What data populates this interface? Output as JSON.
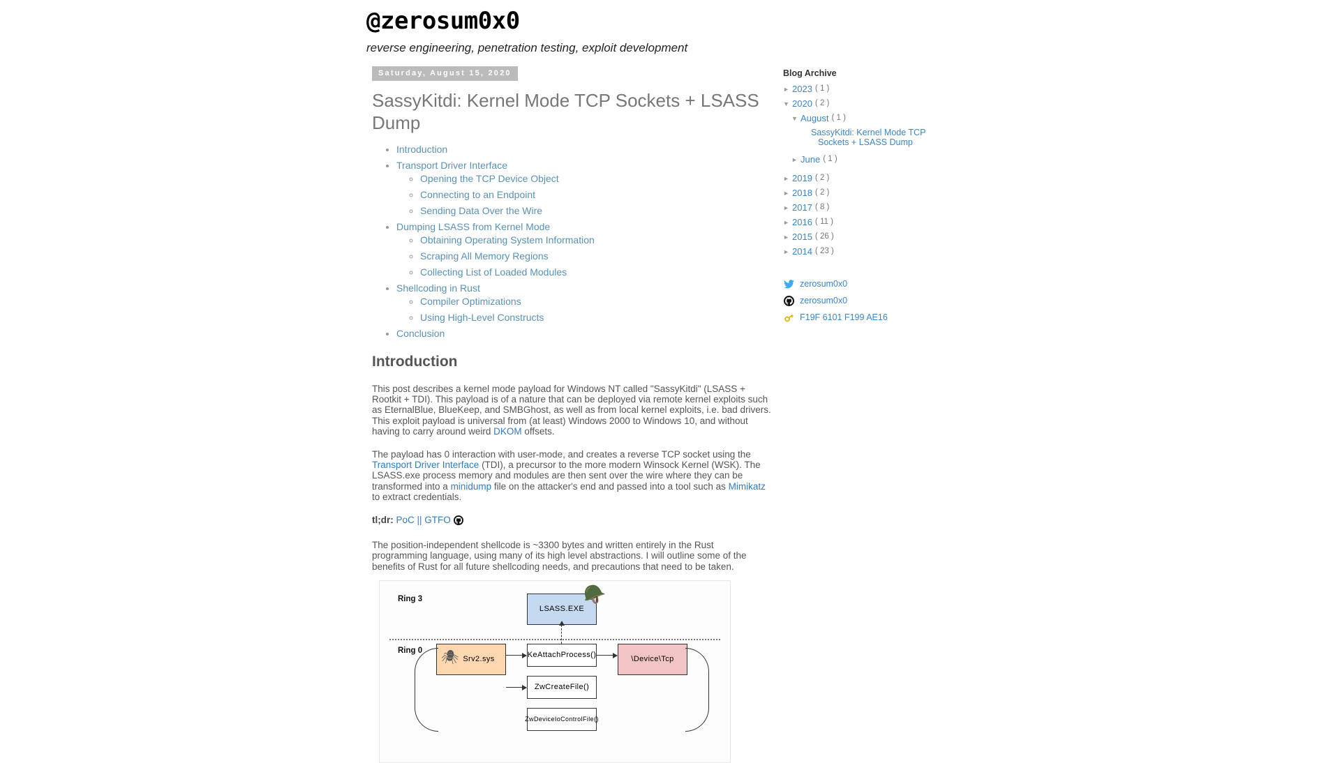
{
  "header": {
    "blog_title": "@zerosum0x0",
    "blog_description": "reverse engineering, penetration testing, exploit development"
  },
  "post": {
    "date": "Saturday, August 15, 2020",
    "title": "SassyKitdi: Kernel Mode TCP Sockets + LSASS Dump",
    "toc": [
      {
        "label": "Introduction",
        "children": []
      },
      {
        "label": "Transport Driver Interface",
        "children": [
          "Opening the TCP Device Object",
          "Connecting to an Endpoint",
          "Sending Data Over the Wire"
        ]
      },
      {
        "label": "Dumping LSASS from Kernel Mode",
        "children": [
          "Obtaining Operating System Information",
          "Scraping All Memory Regions",
          "Collecting List of Loaded Modules"
        ]
      },
      {
        "label": "Shellcoding in Rust",
        "children": [
          "Compiler Optimizations",
          "Using High-Level Constructs"
        ]
      },
      {
        "label": "Conclusion",
        "children": []
      }
    ],
    "section_heading": "Introduction",
    "paragraph1_part1": "This post describes a kernel mode payload for Windows NT called \"SassyKitdi\" (LSASS + Rootkit + TDI). This payload is of a nature that can be deployed via remote kernel exploits such as EternalBlue, BlueKeep, and SMBGhost, as well as from local kernel exploits, i.e. bad drivers. This exploit payload is universal from (at least) Windows 2000 to Windows 10, and without having to carry around weird ",
    "paragraph1_link": "DKOM",
    "paragraph1_part2": " offsets.",
    "paragraph2_part1": "The payload has 0 interaction with user-mode, and creates a reverse TCP socket using the ",
    "paragraph2_link1": "Transport Driver Interface",
    "paragraph2_part2": " (TDI), a precursor to the more modern Winsock Kernel (WSK). The LSASS.exe process memory and modules are then sent over the wire where they can be transformed into a ",
    "paragraph2_link2": "minidump",
    "paragraph2_part3": " file on the attacker's end and passed into a tool such as ",
    "paragraph2_link3": "Mimikatz",
    "paragraph2_part4": " to extract credentials.",
    "tldr_label": "tl;dr:",
    "tldr_link": "PoC || GTFO",
    "paragraph3": "The position-independent shellcode is ~3300 bytes and written entirely in the Rust programming language, using many of its high level abstractions. I will outline some of the benefits of Rust for all future shellcoding needs, and precautions that need to be taken."
  },
  "diagram": {
    "ring3_label": "Ring 3",
    "ring0_label": "Ring 0",
    "lsass_box": "LSASS.EXE",
    "srv_box": "Srv2.sys",
    "ke_box": "KeAttachProcess()",
    "zw_box": "ZwCreateFile()",
    "zw_box2": "ZwDeviceIoControlFile()",
    "device_box": "\\Device\\Tcp"
  },
  "sidebar": {
    "archive_title": "Blog Archive",
    "archive": [
      {
        "level": 1,
        "state": "collapsed",
        "label": "2023",
        "count": "( 1 )"
      },
      {
        "level": 1,
        "state": "expanded",
        "label": "2020",
        "count": "( 2 )"
      },
      {
        "level": 2,
        "state": "expanded",
        "label": "August",
        "count": "( 1 )"
      },
      {
        "level": 2,
        "state": "collapsed",
        "label": "June",
        "count": "( 1 )"
      },
      {
        "level": 1,
        "state": "collapsed",
        "label": "2019",
        "count": "( 2 )"
      },
      {
        "level": 1,
        "state": "collapsed",
        "label": "2018",
        "count": "( 2 )"
      },
      {
        "level": 1,
        "state": "collapsed",
        "label": "2017",
        "count": "( 8 )"
      },
      {
        "level": 1,
        "state": "collapsed",
        "label": "2016",
        "count": "( 11 )"
      },
      {
        "level": 1,
        "state": "collapsed",
        "label": "2015",
        "count": "( 26 )"
      },
      {
        "level": 1,
        "state": "collapsed",
        "label": "2014",
        "count": "( 23 )"
      }
    ],
    "archive_post_link": "SassyKitdi: Kernel Mode TCP Sockets + LSASS Dump",
    "social": [
      {
        "icon": "twitter-icon",
        "label": "zerosum0x0"
      },
      {
        "icon": "github-icon",
        "label": "zerosum0x0"
      },
      {
        "icon": "key-icon",
        "label": "F19F 6101 F199 AE16"
      }
    ]
  },
  "colors": {
    "link": "#3c85c5",
    "toc_link": "#5891b5",
    "date_bg": "#bbbbbb",
    "text": "#555555"
  }
}
